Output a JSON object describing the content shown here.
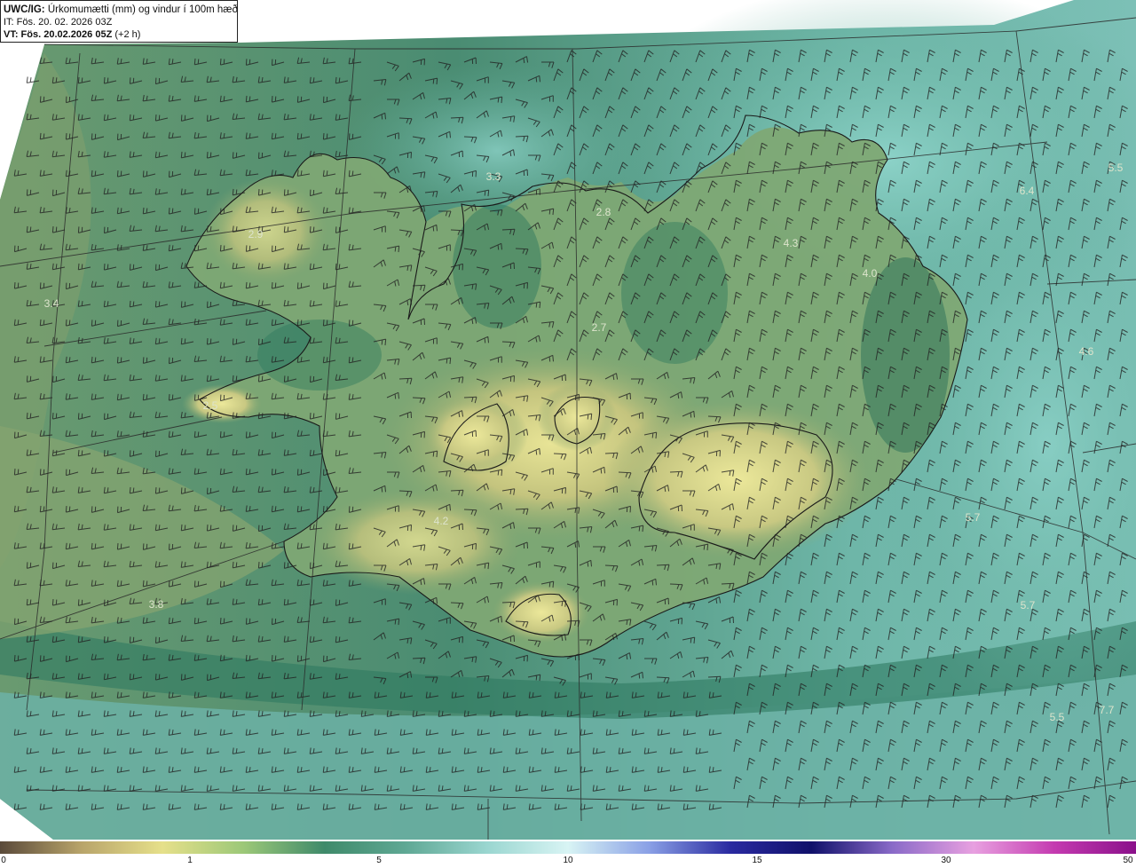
{
  "header": {
    "model": "UWC/IG:",
    "title": "Úrkomumætti (mm) og vindur í 100m hæð",
    "it_line": "IT: Fös. 20. 02. 2026 03Z",
    "vt_label": "VT: Fös. 20.02.2026 05Z",
    "vt_offset": "(+2 h)"
  },
  "map_labels": [
    {
      "text": "3.4"
    },
    {
      "text": "2.9"
    },
    {
      "text": "3.3"
    },
    {
      "text": "2.8"
    },
    {
      "text": "4.3"
    },
    {
      "text": "4.0"
    },
    {
      "text": "6.4"
    },
    {
      "text": "5.5"
    },
    {
      "text": "2.7"
    },
    {
      "text": "2.5"
    },
    {
      "text": "4.6"
    },
    {
      "text": "4.2"
    },
    {
      "text": "3.8"
    },
    {
      "text": "5.7"
    },
    {
      "text": "5.7"
    },
    {
      "text": "5.5"
    },
    {
      "text": "7.7"
    }
  ],
  "colorbar": {
    "ticks": [
      "0",
      "1",
      "5",
      "10",
      "15",
      "30",
      "50"
    ],
    "colors": [
      "#5a4a3a",
      "#b8a46a",
      "#e6e08a",
      "#9cc878",
      "#3f8a6a",
      "#5fa894",
      "#9ad6d0",
      "#d8f4f4",
      "#8aa0e6",
      "#2a2aa0",
      "#10106a",
      "#8a6ac8",
      "#e8a0e0",
      "#c43ab0",
      "#8a108a"
    ]
  }
}
